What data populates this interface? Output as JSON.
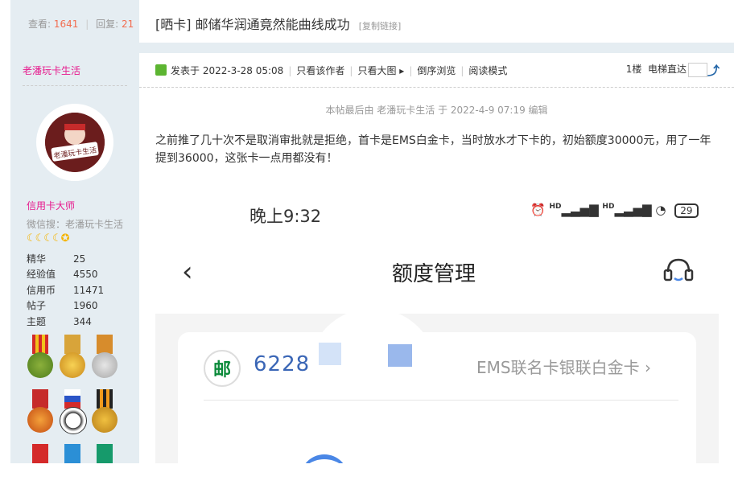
{
  "thread": {
    "views_label": "查看:",
    "views": "1641",
    "replies_label": "回复:",
    "replies": "21",
    "tag": "[晒卡]",
    "title": "邮储华润通竟然能曲线成功",
    "copy_link": "[复制链接]"
  },
  "author": {
    "name": "老潘玩卡生活",
    "avatar_text": "老潘玩卡生活",
    "group": "信用卡大师",
    "wechat": "微信搜：老潘玩卡生活",
    "stars": "☾☾☾☾✪",
    "stats": [
      {
        "label": "精华",
        "value": "25"
      },
      {
        "label": "经验值",
        "value": "4550"
      },
      {
        "label": "信用币",
        "value": "11471"
      },
      {
        "label": "帖子",
        "value": "1960"
      },
      {
        "label": "主题",
        "value": "344"
      }
    ],
    "medal_icons": [
      "medal-bowls-icon",
      "medal-gold-shen-icon",
      "medal-silver-icon",
      "medal-recommend-icon",
      "medal-football-icon",
      "medal-bronze-icon"
    ]
  },
  "post": {
    "posted_at": "发表于 2022-3-28 05:08",
    "only_author": "只看该作者",
    "big_image": "只看大图",
    "reverse": "倒序浏览",
    "reading_mode": "阅读模式",
    "floor": "1楼",
    "jump_label": "电梯直达",
    "edit_note": "本帖最后由 老潘玩卡生活 于 2022-4-9 07:19 编辑",
    "content": "之前推了几十次不是取消审批就是拒绝，首卡是EMS白金卡，当时放水才下卡的，初始额度30000元，用了一年提到36000，这张卡一点用都没有！"
  },
  "screenshot": {
    "time": "晚上9:32",
    "signal": "HD",
    "battery": "29",
    "title": "额度管理",
    "card_number": "6228",
    "card_type": "EMS联名卡银联白金卡",
    "logo_glyph": "邮"
  },
  "colors": {
    "accent_blue": "#2366a8",
    "stat_red": "#f26c4f",
    "author_pink": "#e61a8d",
    "sidebar_bg": "#e5edf2"
  }
}
